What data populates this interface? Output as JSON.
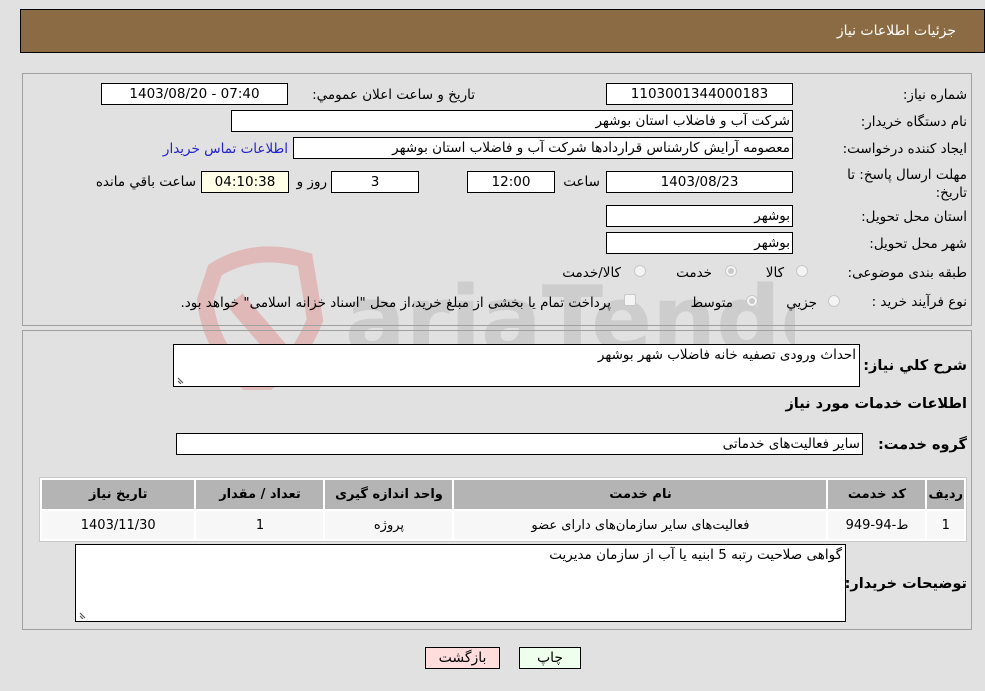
{
  "header": {
    "title": "جزئیات اطلاعات نیاز"
  },
  "form": {
    "need_number": {
      "label": "شماره نیاز:",
      "value": "1103001344000183"
    },
    "announce_datetime": {
      "label": "تاریخ و ساعت اعلان عمومي:",
      "value": "1403/08/20 - 07:40"
    },
    "buyer_org": {
      "label": "نام دستگاه خریدار:",
      "value": "شرکت آب و فاضلاب استان بوشهر"
    },
    "creator": {
      "label": "ایجاد کننده درخواست:",
      "value": "معصومه آرایش کارشناس قراردادها شرکت آب و فاضلاب استان بوشهر"
    },
    "contact_link": "اطلاعات تماس خریدار",
    "deadline": {
      "label": "مهلت ارسال پاسخ: تا تاریخ:",
      "date": "1403/08/23",
      "time_label": "ساعت",
      "time": "12:00",
      "days": "3",
      "days_label": "روز و",
      "remaining": "04:10:38",
      "remaining_label": "ساعت باقي مانده"
    },
    "province": {
      "label": "استان محل تحویل:",
      "value": "بوشهر"
    },
    "city": {
      "label": "شهر محل تحویل:",
      "value": "بوشهر"
    },
    "category": {
      "label": "طبقه بندی موضوعی:",
      "options": [
        "کالا",
        "خدمت",
        "کالا/خدمت"
      ],
      "selected": "خدمت"
    },
    "purchase_type": {
      "label": "نوع فرآیند خرید :",
      "options": [
        "جزیي",
        "متوسط"
      ],
      "selected": "متوسط",
      "treasury_note": "پرداخت تمام یا بخشی از مبلغ خرید،از محل \"اسناد خزانه اسلامی\" خواهد بود."
    }
  },
  "description": {
    "label": "شرح کلي نیاز:",
    "value": "احداث ورودی تصفیه خانه فاضلاب شهر بوشهر"
  },
  "services_section": {
    "title": "اطلاعات خدمات مورد نیاز"
  },
  "service_group": {
    "label": "گروه خدمت:",
    "value": "سایر فعالیت‌های خدماتی"
  },
  "table": {
    "headers": [
      "ردیف",
      "کد خدمت",
      "نام خدمت",
      "واحد اندازه گیری",
      "تعداد / مقدار",
      "تاریخ نیاز"
    ],
    "rows": [
      [
        "1",
        "ط-94-949",
        "فعالیت‌های سایر سازمان‌های دارای عضو",
        "پروژه",
        "1",
        "1403/11/30"
      ]
    ]
  },
  "buyer_notes": {
    "label": "توضیحات خریدار:",
    "value": "گواهی صلاحیت رتبه 5 ابنیه یا آب از سازمان مدیریت"
  },
  "buttons": {
    "print": "چاپ",
    "back": "بازگشت"
  },
  "colors": {
    "header_bg": "#8b6b43",
    "print_bg": "#eeffee",
    "back_bg": "#ffdddd",
    "link": "#2222cc"
  }
}
